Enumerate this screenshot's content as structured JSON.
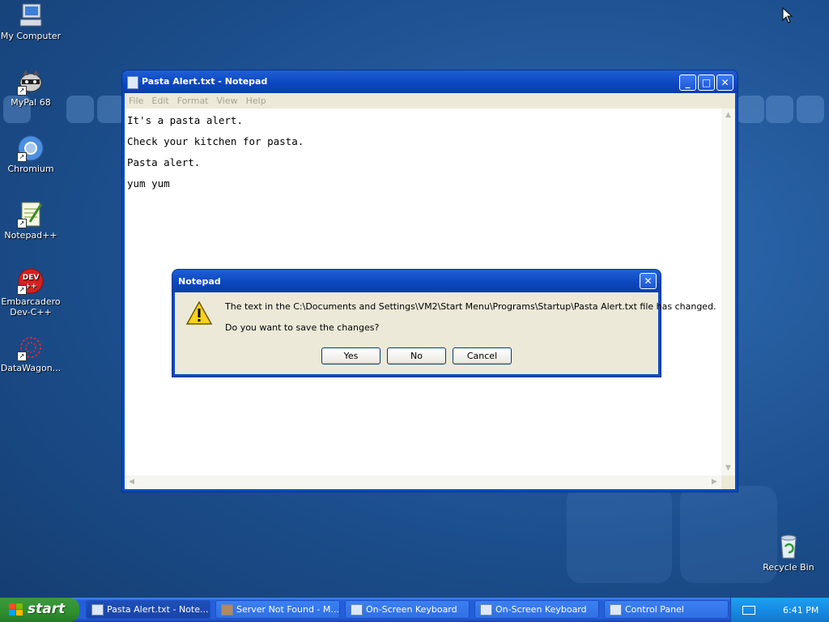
{
  "desktop": {
    "icons": [
      {
        "label": "My Computer"
      },
      {
        "label": "MyPal 68"
      },
      {
        "label": "Chromium"
      },
      {
        "label": "Notepad++"
      },
      {
        "label": "Embarcadero Dev-C++"
      },
      {
        "label": "DataWagon..."
      },
      {
        "label": "Recycle Bin"
      }
    ]
  },
  "notepad": {
    "title": "Pasta Alert.txt - Notepad",
    "menu": [
      "File",
      "Edit",
      "Format",
      "View",
      "Help"
    ],
    "content_lines": [
      "It's a pasta alert.",
      "Check your kitchen for pasta.",
      "Pasta alert.",
      "yum yum"
    ],
    "buttons": {
      "minimize": "_",
      "maximize": "□",
      "close": "✕"
    }
  },
  "dialog": {
    "title": "Notepad",
    "message_line1": "The text in the C:\\Documents and Settings\\VM2\\Start Menu\\Programs\\Startup\\Pasta Alert.txt file has changed.",
    "message_line2": "Do you want to save the changes?",
    "yes_label": "Yes",
    "no_label": "No",
    "cancel_label": "Cancel",
    "close": "✕"
  },
  "taskbar": {
    "start_label": "start",
    "tasks": [
      {
        "label": "Pasta Alert.txt - Note..."
      },
      {
        "label": "Server Not Found - M..."
      },
      {
        "label": "On-Screen Keyboard"
      },
      {
        "label": "On-Screen Keyboard"
      },
      {
        "label": "Control Panel"
      }
    ],
    "clock": "6:41 PM"
  },
  "colors": {
    "desktop_bg": "#1c4f8e",
    "titlebar": "#0a46bd",
    "taskbar": "#245edb",
    "start_button": "#2f8f2f",
    "dialog_body": "#ece9d8"
  }
}
